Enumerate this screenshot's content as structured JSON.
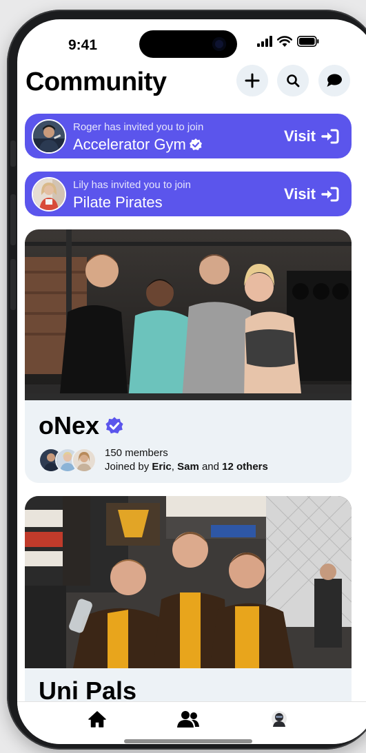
{
  "status": {
    "time": "9:41"
  },
  "header": {
    "title": "Community"
  },
  "invites": [
    {
      "subtitle": "Roger has invited you to join",
      "group": "Accelerator Gym",
      "verified": true,
      "action": "Visit"
    },
    {
      "subtitle": "Lily has invited you to join",
      "group": "Pilate Pirates",
      "verified": false,
      "action": "Visit"
    }
  ],
  "communities": [
    {
      "name": "oNex",
      "verified": true,
      "members": "150 members",
      "joined": {
        "prefix": "Joined by ",
        "name1": "Eric",
        "sep": ", ",
        "name2": "Sam",
        "and": " and ",
        "others": "12 others"
      }
    },
    {
      "name": "Uni Pals"
    }
  ],
  "tabs": [
    "home",
    "community",
    "profile"
  ],
  "colors": {
    "accent": "#5b55ec",
    "card_bg": "#edf2f6",
    "button_bg": "#eaf0f5"
  }
}
